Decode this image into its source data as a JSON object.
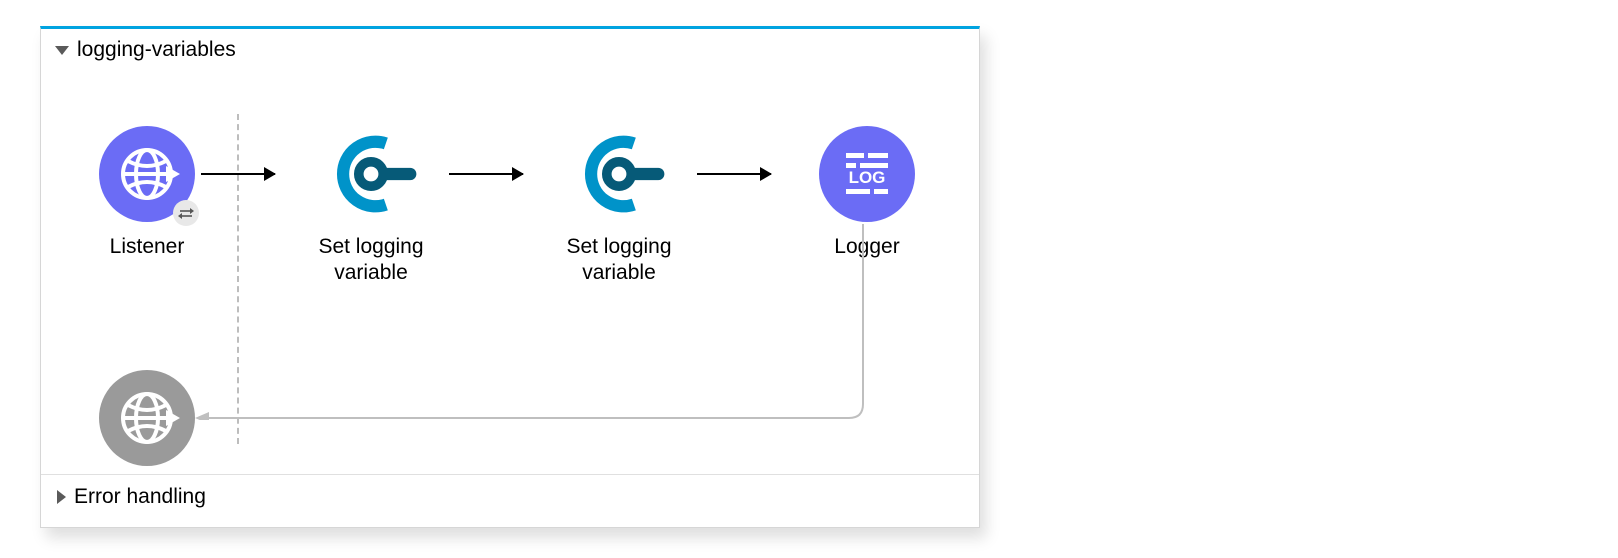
{
  "flow": {
    "title": "logging-variables",
    "nodes": {
      "listener": {
        "label": "Listener",
        "icon": "http-listener",
        "color": "purple"
      },
      "setvar1": {
        "label": "Set logging\nvariable",
        "icon": "tracing-connector",
        "color": "cyan"
      },
      "setvar2": {
        "label": "Set logging\nvariable",
        "icon": "tracing-connector",
        "color": "cyan"
      },
      "logger": {
        "label": "Logger",
        "icon": "logger",
        "color": "purple"
      },
      "response": {
        "label": "",
        "icon": "http-listener",
        "color": "grey"
      }
    },
    "error_section": "Error handling"
  }
}
